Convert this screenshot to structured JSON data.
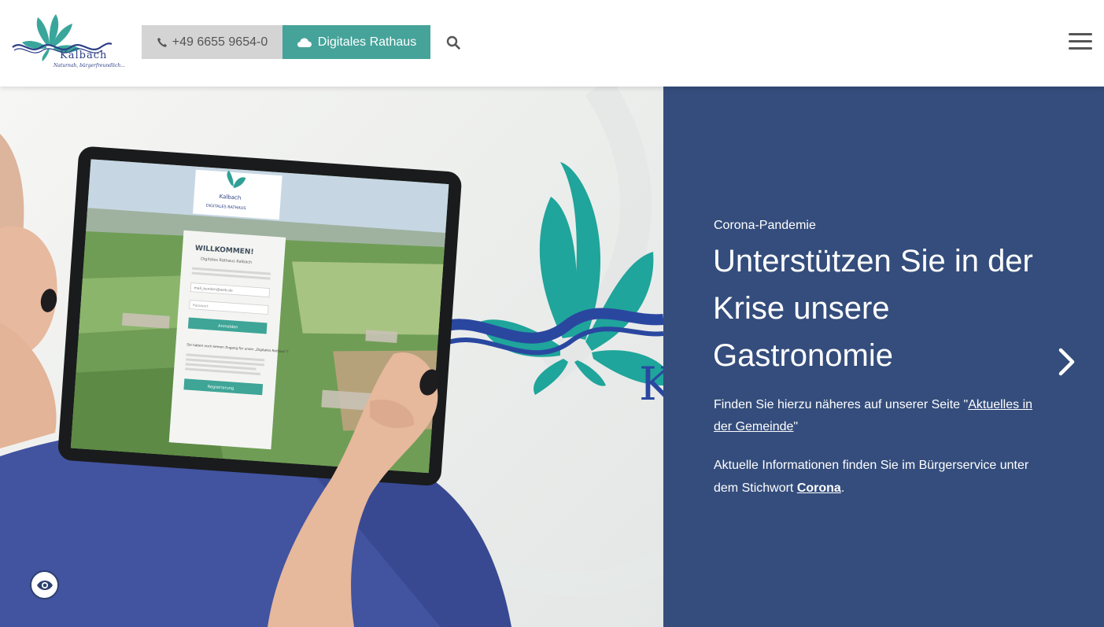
{
  "brand": {
    "name": "Kalbach",
    "tagline": "Naturnah, bürgerfreundlich...",
    "colors": {
      "teal": "#45a39a",
      "navy": "#344d7c",
      "logo_blue": "#2c3e86"
    }
  },
  "header": {
    "phone_label": "+49 6655 9654-0",
    "phone_icon": "phone-icon",
    "rathaus_label": "Digitales Rathaus",
    "rathaus_icon": "cloud-icon",
    "search_icon": "search-icon",
    "menu_icon": "hamburger-menu-icon"
  },
  "tablet": {
    "heading": "WILLKOMMEN!",
    "subheading": "Digitales Rathaus Kalbach",
    "logo_word": "Kalbach",
    "logo_sub": "DIGITALES RATHAUS",
    "email_placeholder": "mail_kunden@web.de",
    "password_placeholder": "Passwort",
    "login_button": "Anmelden",
    "register_prompt": "Sie haben noch keinen Zugang für unser „Digitales Rathaus\"?",
    "register_button": "Registrierung"
  },
  "slide": {
    "eyebrow": "Corona-Pandemie",
    "headline": "Unterstützen Sie in der Krise unsere Gastronomie",
    "p1_before": "Finden Sie hierzu näheres auf unserer Seite \"",
    "p1_link": "Aktuelles in der Gemeinde",
    "p1_after": "\"",
    "p2_before": "Aktuelle Informationen finden Sie im Bürgerservice unter dem Stichwort ",
    "p2_link": "Corona",
    "p2_after": ".",
    "next_icon": "chevron-right-icon"
  },
  "accessibility": {
    "icon": "eye-icon"
  }
}
